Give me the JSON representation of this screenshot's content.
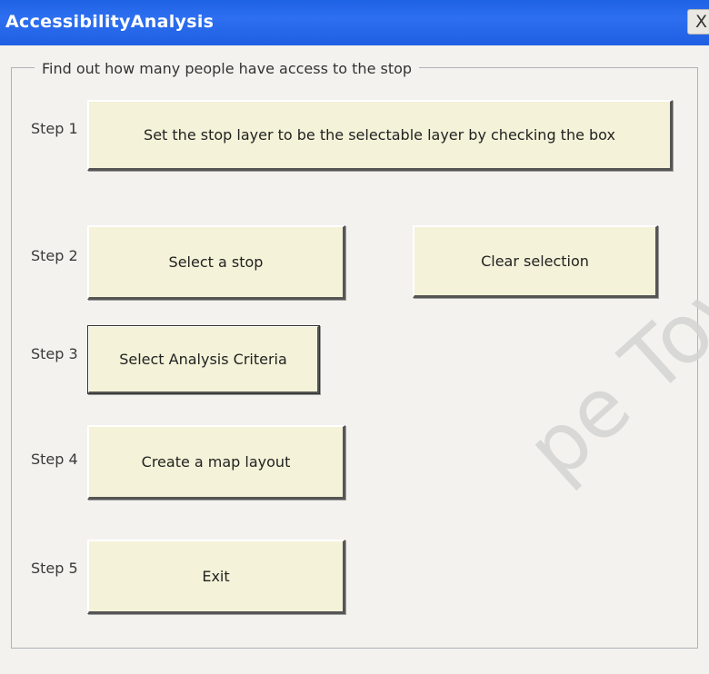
{
  "window": {
    "title": "AccessibilityAnalysis",
    "close_label": "X"
  },
  "frame": {
    "caption": "Find out how many people have access to the stop"
  },
  "steps": [
    {
      "label": "Step 1",
      "button": "Set the stop layer to be the selectable layer by checking the box"
    },
    {
      "label": "Step 2",
      "button": "Select a stop"
    },
    {
      "label": "Step 3",
      "button": "Select Analysis Criteria"
    },
    {
      "label": "Step 4",
      "button": "Create a map layout"
    },
    {
      "label": "Step 5",
      "button": "Exit"
    }
  ],
  "extra_buttons": {
    "clear_selection": "Clear selection"
  },
  "watermark": {
    "text": "pe Town"
  }
}
